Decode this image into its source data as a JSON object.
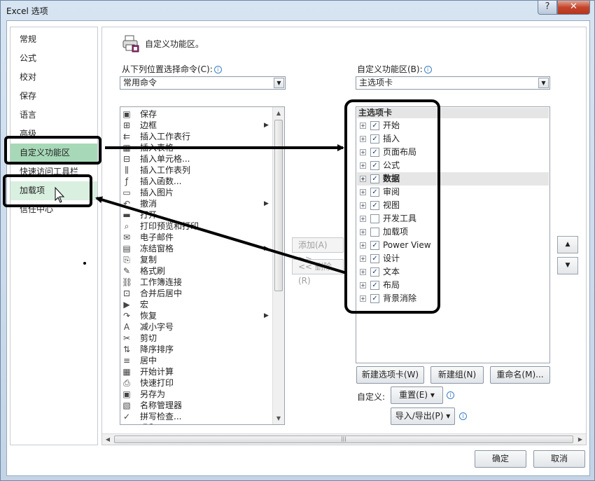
{
  "window": {
    "title": "Excel 选项",
    "help": "?",
    "close": "✕"
  },
  "nav": {
    "items": [
      {
        "label": "常规",
        "state": ""
      },
      {
        "label": "公式",
        "state": ""
      },
      {
        "label": "校对",
        "state": ""
      },
      {
        "label": "保存",
        "state": ""
      },
      {
        "label": "语言",
        "state": ""
      },
      {
        "label": "高级",
        "state": ""
      },
      {
        "label": "自定义功能区",
        "state": "sel"
      },
      {
        "label": "快速访问工具栏",
        "state": ""
      },
      {
        "label": "加载项",
        "state": "hover"
      },
      {
        "label": "信任中心",
        "state": ""
      }
    ]
  },
  "header": {
    "title": "自定义功能区。"
  },
  "commands": {
    "label": "从下列位置选择命令(C):",
    "selected": "常用命令",
    "items": [
      {
        "icon": "save-icon",
        "glyph": "▣",
        "label": "保存",
        "sub": false
      },
      {
        "icon": "border-icon",
        "glyph": "⊞",
        "label": "边框",
        "sub": true
      },
      {
        "icon": "insert-row-icon",
        "glyph": "⇇",
        "label": "插入工作表行",
        "sub": false
      },
      {
        "icon": "table-icon",
        "glyph": "▦",
        "label": "插入表格",
        "sub": false
      },
      {
        "icon": "insert-cell-icon",
        "glyph": "⊟",
        "label": "插入单元格...",
        "sub": false
      },
      {
        "icon": "insert-col-icon",
        "glyph": "⫼",
        "label": "插入工作表列",
        "sub": false
      },
      {
        "icon": "function-icon",
        "glyph": "ƒ",
        "label": "插入函数...",
        "sub": false
      },
      {
        "icon": "picture-icon",
        "glyph": "▭",
        "label": "插入图片",
        "sub": false
      },
      {
        "icon": "undo-icon",
        "glyph": "↶",
        "label": "撤消",
        "sub": true
      },
      {
        "icon": "folder-icon",
        "glyph": "▬",
        "label": "打开",
        "sub": false
      },
      {
        "icon": "print-preview-icon",
        "glyph": "⌕",
        "label": "打印预览和打印",
        "sub": false
      },
      {
        "icon": "mail-icon",
        "glyph": "✉",
        "label": "电子邮件",
        "sub": false
      },
      {
        "icon": "freeze-icon",
        "glyph": "▤",
        "label": "冻结窗格",
        "sub": true
      },
      {
        "icon": "copy-icon",
        "glyph": "⎘",
        "label": "复制",
        "sub": false
      },
      {
        "icon": "brush-icon",
        "glyph": "✎",
        "label": "格式刷",
        "sub": false
      },
      {
        "icon": "link-icon",
        "glyph": "⛓",
        "label": "工作簿连接",
        "sub": false
      },
      {
        "icon": "merge-icon",
        "glyph": "⊡",
        "label": "合并后居中",
        "sub": false
      },
      {
        "icon": "macro-icon",
        "glyph": "▶",
        "label": "宏",
        "sub": false
      },
      {
        "icon": "redo-icon",
        "glyph": "↷",
        "label": "恢复",
        "sub": true
      },
      {
        "icon": "font-smaller-icon",
        "glyph": "A",
        "label": "减小字号",
        "sub": false
      },
      {
        "icon": "cut-icon",
        "glyph": "✂",
        "label": "剪切",
        "sub": false
      },
      {
        "icon": "sort-desc-icon",
        "glyph": "⇅",
        "label": "降序排序",
        "sub": false
      },
      {
        "icon": "center-icon",
        "glyph": "≡",
        "label": "居中",
        "sub": false
      },
      {
        "icon": "calculate-icon",
        "glyph": "▦",
        "label": "开始计算",
        "sub": false
      },
      {
        "icon": "quick-print-icon",
        "glyph": "⎙",
        "label": "快速打印",
        "sub": false
      },
      {
        "icon": "save-as-icon",
        "glyph": "▣",
        "label": "另存为",
        "sub": false
      },
      {
        "icon": "name-manager-icon",
        "glyph": "▧",
        "label": "名称管理器",
        "sub": false
      },
      {
        "icon": "spellcheck-icon",
        "glyph": "✓",
        "label": "拼写检查...",
        "sub": false
      },
      {
        "icon": "more-icon",
        "glyph": "↘",
        "label": "求和",
        "sub": false
      }
    ]
  },
  "middle": {
    "add": "添加(A) >>",
    "remove": "<< 删除(R)"
  },
  "ribbon": {
    "label": "自定义功能区(B):",
    "selected": "主选项卡",
    "tree_head": "主选项卡",
    "tabs": [
      {
        "label": "开始",
        "checked": true,
        "hl": false
      },
      {
        "label": "插入",
        "checked": true,
        "hl": false
      },
      {
        "label": "页面布局",
        "checked": true,
        "hl": false
      },
      {
        "label": "公式",
        "checked": true,
        "hl": false
      },
      {
        "label": "数据",
        "checked": true,
        "hl": true
      },
      {
        "label": "审阅",
        "checked": true,
        "hl": false
      },
      {
        "label": "视图",
        "checked": true,
        "hl": false
      },
      {
        "label": "开发工具",
        "checked": false,
        "hl": false
      },
      {
        "label": "加载项",
        "checked": false,
        "hl": false
      },
      {
        "label": "Power View",
        "checked": true,
        "hl": false
      },
      {
        "label": "设计",
        "checked": true,
        "hl": false
      },
      {
        "label": "文本",
        "checked": true,
        "hl": false
      },
      {
        "label": "布局",
        "checked": true,
        "hl": false
      },
      {
        "label": "背景消除",
        "checked": true,
        "hl": false
      }
    ],
    "new_tab": "新建选项卡(W)",
    "new_group": "新建组(N)",
    "rename": "重命名(M)...",
    "customize_label": "自定义:",
    "reset": "重置(E) ▾",
    "import_export": "导入/导出(P) ▾"
  },
  "footer": {
    "ok": "确定",
    "cancel": "取消"
  },
  "colors": {
    "selected_nav": "#a7d9b8",
    "hover_nav": "#d9f0e0",
    "annotation": "#000000"
  }
}
